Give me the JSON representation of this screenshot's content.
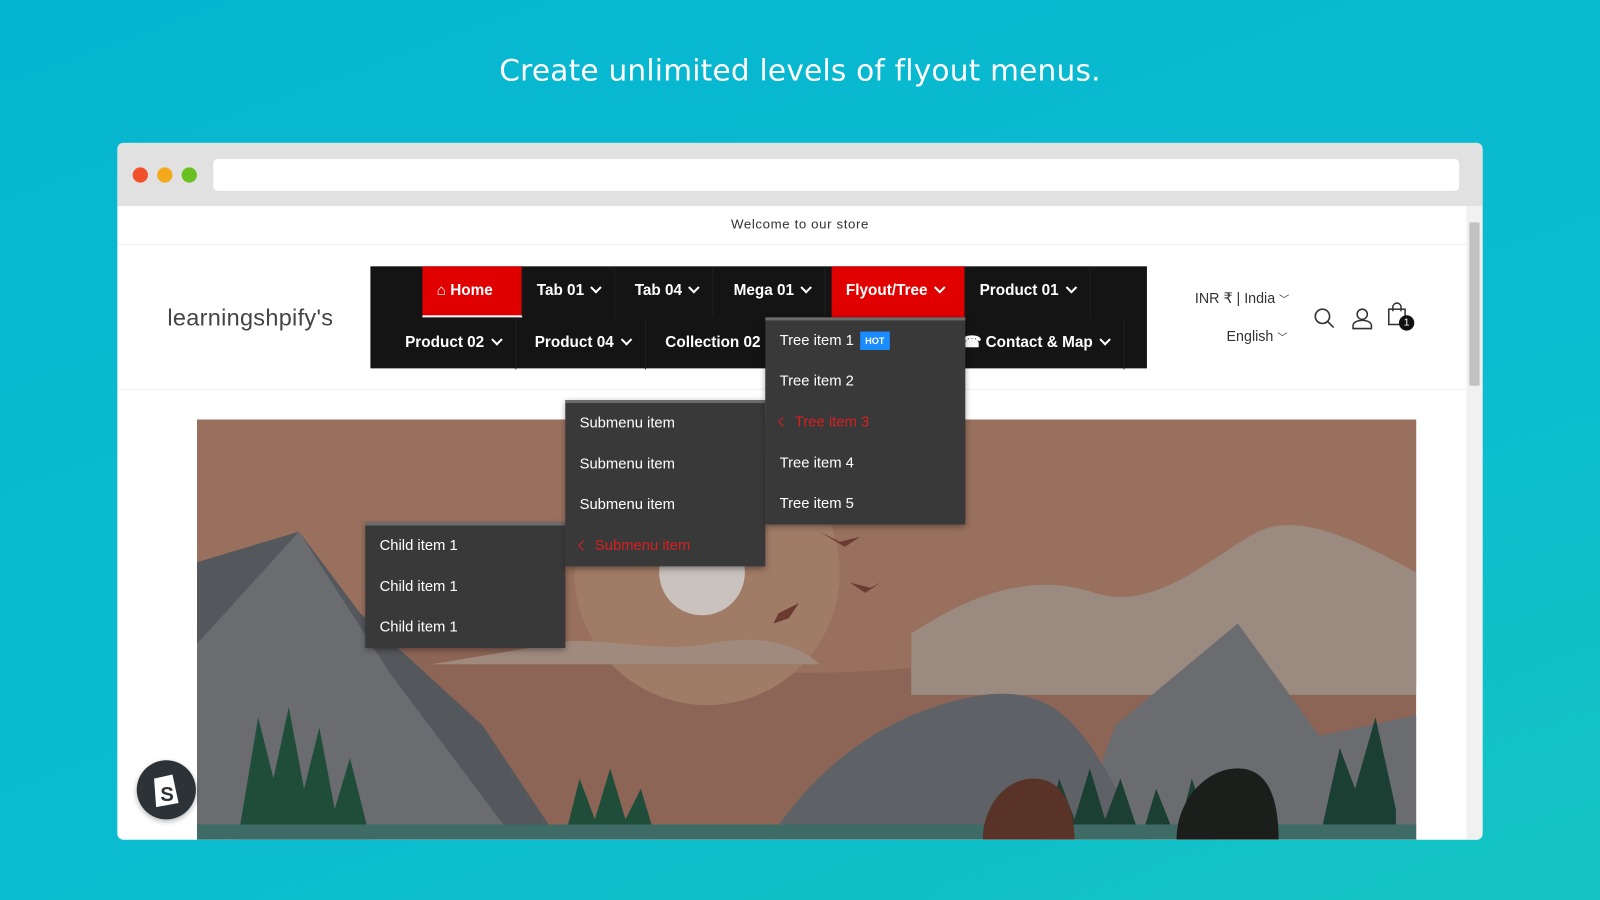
{
  "headline": "Create unlimited levels of flyout menus.",
  "announcement": "Welcome to our store",
  "logo": "learningshpify's",
  "nav": {
    "row1": [
      {
        "label": "Home",
        "icon": "home-icon"
      },
      {
        "label": "Tab 01"
      },
      {
        "label": "Tab 04"
      },
      {
        "label": "Mega 01"
      },
      {
        "label": "Flyout/Tree"
      },
      {
        "label": "Product 01"
      }
    ],
    "row2": [
      {
        "label": "Product 02"
      },
      {
        "label": "Product 04"
      },
      {
        "label": "Collection 02"
      },
      {
        "label": "Contact & Map"
      }
    ]
  },
  "currency": "INR ₹ | India",
  "language": "English",
  "cart_count": "1",
  "tree_menu": [
    "Tree item 1",
    "Tree item 2",
    "Tree item 3",
    "Tree item 4",
    "Tree item 5"
  ],
  "hot_badge": "HOT",
  "submenu": [
    "Submenu item",
    "Submenu item",
    "Submenu item",
    "Submenu item"
  ],
  "child_menu": [
    "Child item 1",
    "Child item 1",
    "Child item 1"
  ],
  "colors": {
    "accent": "#e10000",
    "nav_bg": "#141414",
    "menu_bg": "#3a393a",
    "active_text": "#d62020",
    "hot": "#1a8cff"
  }
}
